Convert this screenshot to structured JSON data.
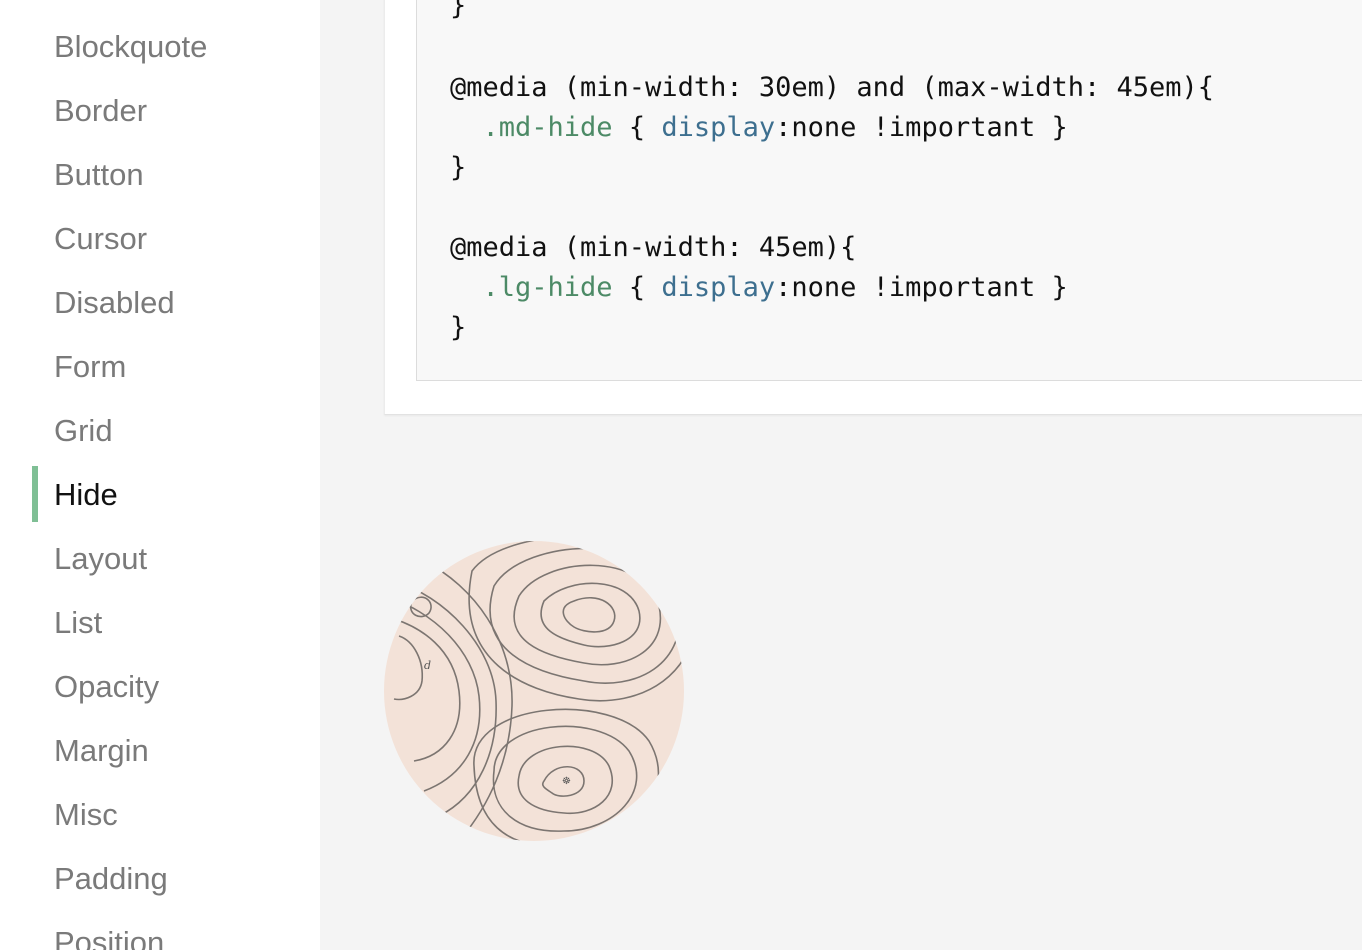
{
  "sidebar": {
    "items": [
      {
        "label": "Blockquote"
      },
      {
        "label": "Border"
      },
      {
        "label": "Button"
      },
      {
        "label": "Cursor"
      },
      {
        "label": "Disabled"
      },
      {
        "label": "Form"
      },
      {
        "label": "Grid"
      },
      {
        "label": "Hide",
        "active": true
      },
      {
        "label": "Layout"
      },
      {
        "label": "List"
      },
      {
        "label": "Opacity"
      },
      {
        "label": "Margin"
      },
      {
        "label": "Misc"
      },
      {
        "label": "Padding"
      },
      {
        "label": "Position"
      }
    ],
    "accent_color": "#7fbf95"
  },
  "code": {
    "lines": [
      {
        "parts": [
          {
            "t": "}"
          }
        ]
      },
      {
        "parts": [
          {
            "t": "@media (min-width: 30em) and (max-width: 45em){"
          }
        ]
      },
      {
        "parts": [
          {
            "t": "  "
          },
          {
            "t": ".md-hide",
            "c": "class"
          },
          {
            "t": " { "
          },
          {
            "t": "display",
            "c": "prop"
          },
          {
            "t": ":none !important }"
          }
        ]
      },
      {
        "parts": [
          {
            "t": "}"
          }
        ]
      },
      {
        "parts": [
          {
            "t": "@media (min-width: 45em){"
          }
        ]
      },
      {
        "parts": [
          {
            "t": "  "
          },
          {
            "t": ".lg-hide",
            "c": "class"
          },
          {
            "t": " { "
          },
          {
            "t": "display",
            "c": "prop"
          },
          {
            "t": ":none !important }"
          }
        ]
      },
      {
        "parts": [
          {
            "t": "}"
          }
        ]
      }
    ]
  },
  "image": {
    "icon": "topographic-map-image",
    "map_label": "d"
  }
}
